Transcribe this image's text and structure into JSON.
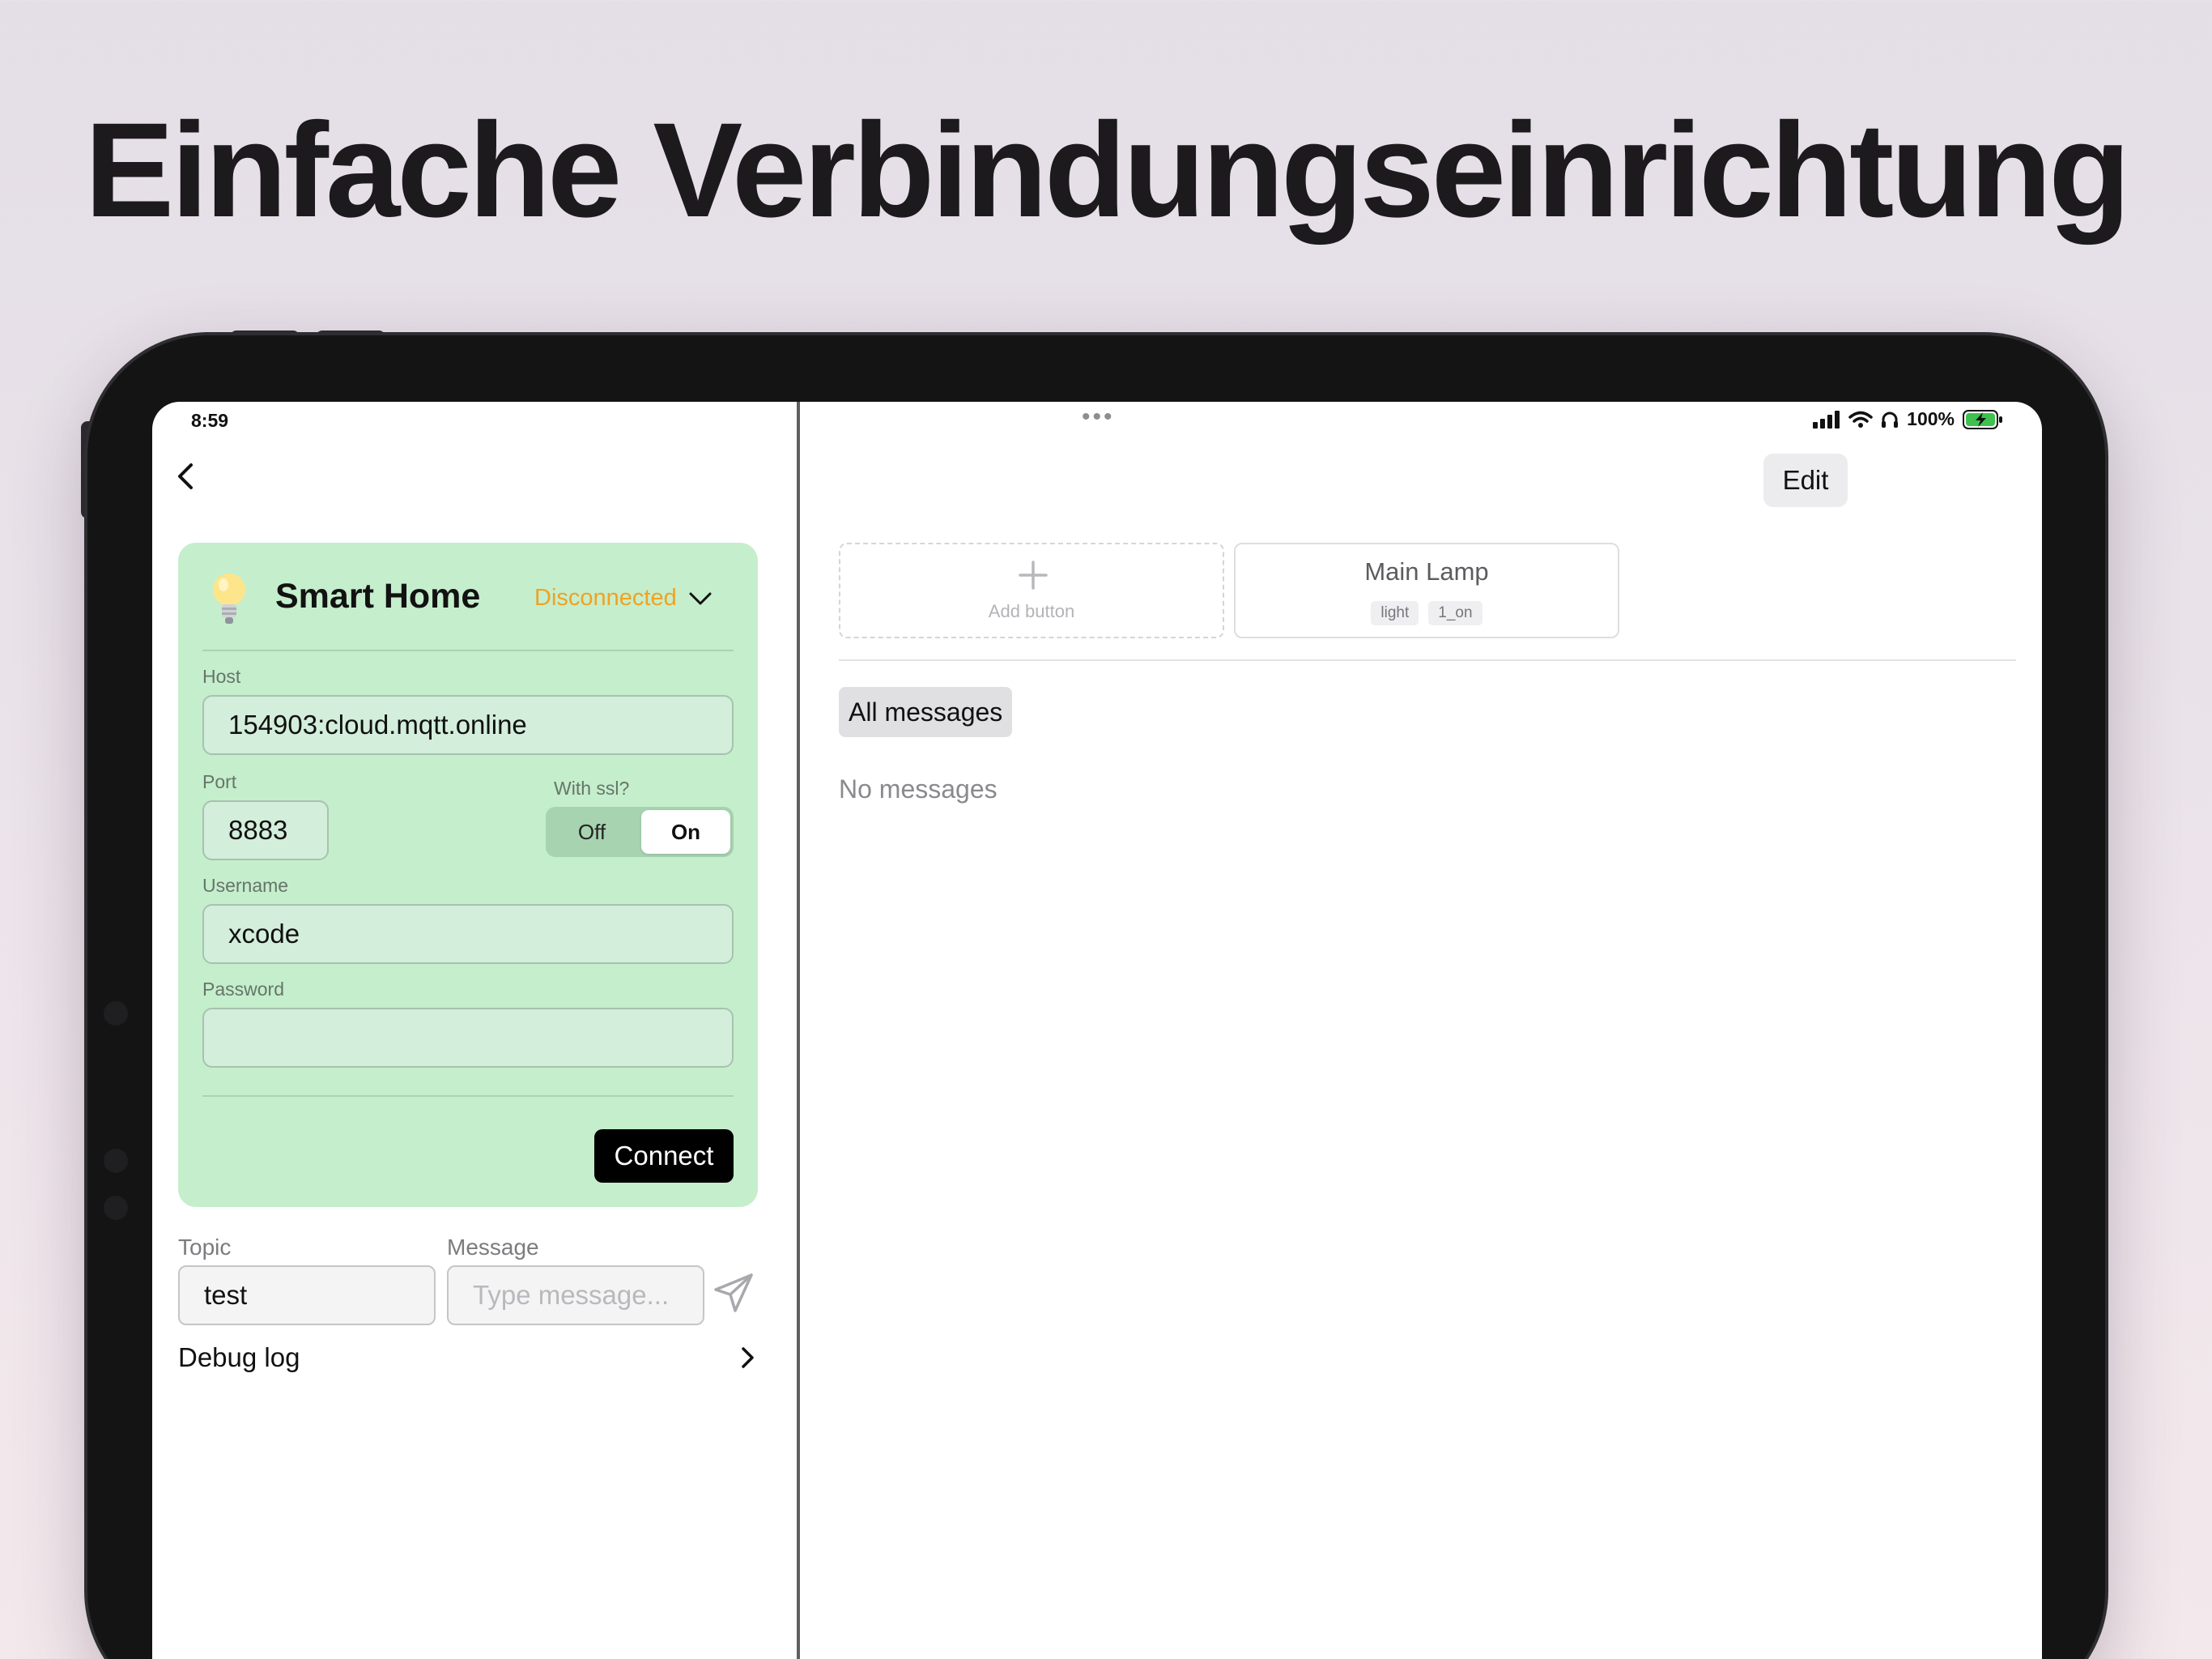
{
  "headline": "Einfache Verbindungseinrichtung",
  "status_bar": {
    "time": "8:59",
    "battery": "100%",
    "icons": [
      "signal-icon",
      "wifi-icon",
      "headphones-icon",
      "battery-charging-icon"
    ]
  },
  "connection": {
    "name": "Smart Home",
    "status": "Disconnected",
    "status_color": "#f0a221",
    "card_color": "#c5eecc",
    "host_label": "Host",
    "host_value": "154903:cloud.mqtt.online",
    "port_label": "Port",
    "port_value": "8883",
    "ssl_label": "With ssl?",
    "ssl_off": "Off",
    "ssl_on": "On",
    "ssl_selected": "On",
    "username_label": "Username",
    "username_value": "xcode",
    "password_label": "Password",
    "password_value": "",
    "connect_label": "Connect"
  },
  "publish": {
    "topic_label": "Topic",
    "topic_value": "test",
    "message_label": "Message",
    "message_placeholder": "Type message..."
  },
  "debug_label": "Debug log",
  "right_pane": {
    "edit_label": "Edit",
    "add_button_label": "Add button",
    "buttons": [
      {
        "title": "Main Lamp",
        "tags": [
          "light",
          "1_on"
        ]
      }
    ],
    "filter_label": "All messages",
    "empty_label": "No messages"
  }
}
